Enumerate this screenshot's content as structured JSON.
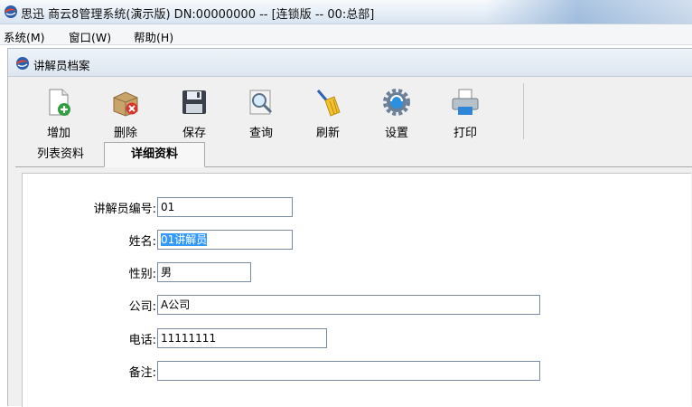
{
  "app": {
    "title": "思迅 商云8管理系统(演示版) DN:00000000 -- [连锁版 -- 00:总部]"
  },
  "menu": [
    {
      "label": "系统(M)"
    },
    {
      "label": "窗口(W)"
    },
    {
      "label": "帮助(H)"
    }
  ],
  "child_window": {
    "title": "讲解员档案"
  },
  "toolbar": {
    "buttons": [
      {
        "label": "增加",
        "icon": "add-document-icon"
      },
      {
        "label": "删除",
        "icon": "delete-box-icon"
      },
      {
        "label": "保存",
        "icon": "floppy-disk-icon"
      },
      {
        "label": "查询",
        "icon": "magnifier-icon"
      },
      {
        "label": "刷新",
        "icon": "broom-icon"
      },
      {
        "label": "设置",
        "icon": "gear-icon"
      },
      {
        "label": "打印",
        "icon": "printer-icon"
      }
    ]
  },
  "tabs": [
    {
      "label": "列表资料",
      "active": false
    },
    {
      "label": "详细资料",
      "active": true
    }
  ],
  "form": {
    "fields": [
      {
        "label": "讲解员编号:",
        "value": "01"
      },
      {
        "label": "姓名:",
        "value": "01讲解员",
        "selected": true
      },
      {
        "label": "性别:",
        "value": "男"
      },
      {
        "label": "公司:",
        "value": "A公司"
      },
      {
        "label": "电话:",
        "value": "11111111"
      },
      {
        "label": "备注:",
        "value": ""
      }
    ]
  },
  "colors": {
    "selection": "#3399ff",
    "field_border": "#7a8aa0",
    "panel_bg": "#ffffff",
    "window_bg": "#f0f0f0"
  }
}
